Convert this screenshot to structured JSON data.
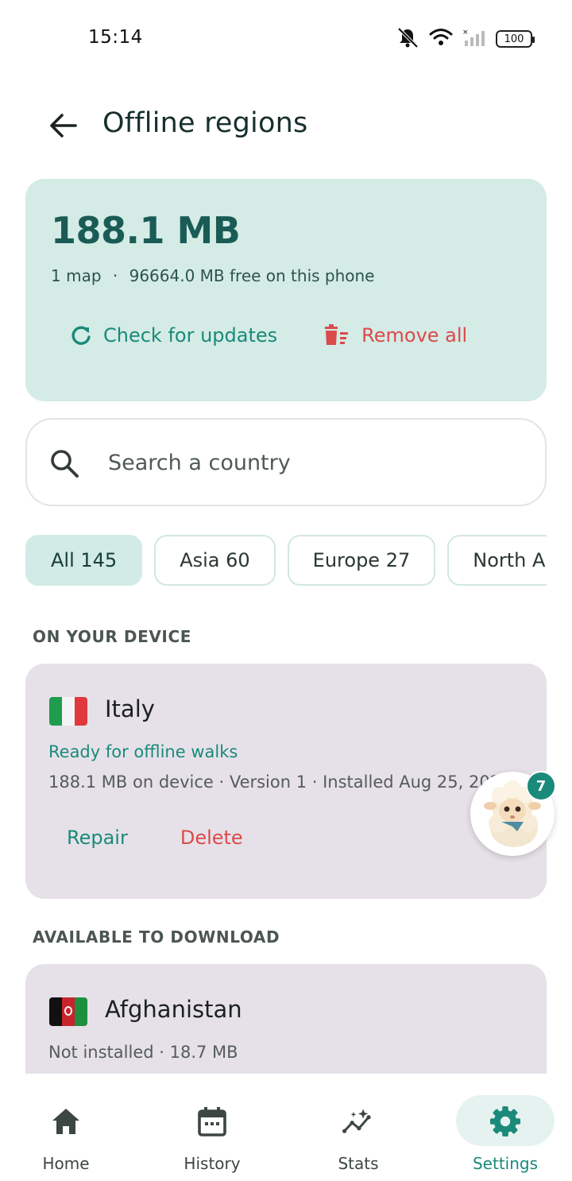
{
  "status_bar": {
    "time": "15:14",
    "battery": "100"
  },
  "header": {
    "title": "Offline regions"
  },
  "storage": {
    "total": "188.1 MB",
    "maps": "1 map",
    "free": "96664.0 MB free on this phone",
    "separator": "·",
    "check_updates_label": "Check for updates",
    "remove_all_label": "Remove all"
  },
  "search": {
    "placeholder": "Search a country"
  },
  "filters": [
    {
      "label": "All 145",
      "active": true
    },
    {
      "label": "Asia 60",
      "active": false
    },
    {
      "label": "Europe 27",
      "active": false
    },
    {
      "label": "North America",
      "active": false
    }
  ],
  "sections": {
    "on_device": "ON YOUR DEVICE",
    "available": "AVAILABLE TO DOWNLOAD"
  },
  "installed_region": {
    "name": "Italy",
    "status": "Ready for offline walks",
    "meta": "188.1 MB on device  ·  Version 1  ·  Installed Aug 25, 2025",
    "repair_label": "Repair",
    "delete_label": "Delete"
  },
  "available_region": {
    "name": "Afghanistan",
    "meta": "Not installed  ·  18.7 MB"
  },
  "mascot": {
    "badge_count": "7"
  },
  "nav": {
    "home": "Home",
    "history": "History",
    "stats": "Stats",
    "settings": "Settings",
    "active": "settings"
  },
  "colors": {
    "accent": "#1a8a7a",
    "danger": "#dc4a4a",
    "storage_card_bg": "#d4ebe6",
    "region_card_bg": "#e6e1e8"
  }
}
